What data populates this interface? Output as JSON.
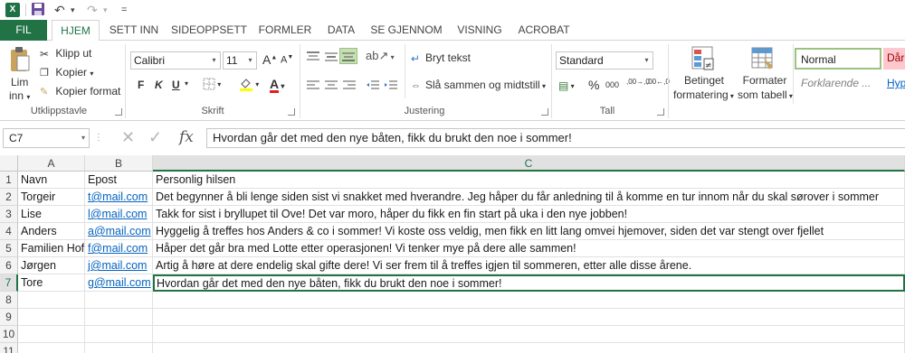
{
  "quick_access": {
    "logo": "X",
    "undo": "↶",
    "redo": "↷",
    "customize": "="
  },
  "tabs": [
    {
      "label": "FIL"
    },
    {
      "label": "HJEM"
    },
    {
      "label": "SETT INN"
    },
    {
      "label": "SIDEOPPSETT"
    },
    {
      "label": "FORMLER"
    },
    {
      "label": "DATA"
    },
    {
      "label": "SE GJENNOM"
    },
    {
      "label": "VISNING"
    },
    {
      "label": "ACROBAT"
    }
  ],
  "ribbon": {
    "clipboard": {
      "paste_label_1": "Lim",
      "paste_label_2": "inn",
      "cut": "Klipp ut",
      "copy": "Kopier",
      "format_painter": "Kopier format",
      "group": "Utklippstavle"
    },
    "font": {
      "name": "Calibri",
      "size": "11",
      "bold": "F",
      "italic": "K",
      "underline": "U",
      "grow": "A",
      "shrink": "A",
      "color_letter": "A",
      "group": "Skrift"
    },
    "alignment": {
      "wrap_text": "Bryt tekst",
      "merge_center": "Slå sammen og midtstill",
      "group": "Justering"
    },
    "number": {
      "format": "Standard",
      "percent": "%",
      "thousands": "000",
      "dec_inc": ",00→,0",
      "dec_dec": ",00←,0",
      "group": "Tall"
    },
    "styles": {
      "conditional_1": "Betinget",
      "conditional_2": "formatering",
      "format_table_1": "Formater",
      "format_table_2": "som tabell",
      "normal": "Normal",
      "bad": "Dårl",
      "explanatory": "Forklarende ...",
      "hyperlink": "Hyp"
    }
  },
  "formula_bar": {
    "name_box": "C7",
    "cancel": "✕",
    "enter": "✓",
    "fx": "fx",
    "content": "Hvordan går det med den nye båten, fikk du brukt den noe i sommer!"
  },
  "columns": [
    "A",
    "B",
    "C"
  ],
  "rows": [
    {
      "num": "1",
      "a": "Navn",
      "b": "Epost",
      "c": "Personlig hilsen"
    },
    {
      "num": "2",
      "a": "Torgeir",
      "b": "t@mail.com",
      "c": "Det begynner å bli lenge siden sist vi snakket med hverandre. Jeg håper du får anledning til å komme en tur innom når du skal sørover i sommer"
    },
    {
      "num": "3",
      "a": "Lise",
      "b": "l@mail.com",
      "c": "Takk for sist i bryllupet til Ove! Det var moro, håper du fikk en fin start på uka i den nye jobben!"
    },
    {
      "num": "4",
      "a": "Anders",
      "b": "a@mail.com",
      "c": "Hyggelig å treffes hos Anders & co i sommer! Vi koste oss veldig, men fikk en litt lang omvei hjemover, siden det var stengt over fjellet"
    },
    {
      "num": "5",
      "a": "Familien Hof",
      "b": "f@mail.com",
      "c": "Håper det går bra med Lotte etter operasjonen! Vi tenker mye på dere alle sammen!"
    },
    {
      "num": "6",
      "a": "Jørgen",
      "b": "j@mail.com",
      "c": "Artig å høre at dere endelig skal gifte dere! Vi ser frem til å treffes igjen til sommeren, etter alle disse årene."
    },
    {
      "num": "7",
      "a": "Tore",
      "b": "g@mail.com",
      "c": "Hvordan går det med den nye båten, fikk du brukt den noe i sommer!"
    },
    {
      "num": "8",
      "a": "",
      "b": "",
      "c": ""
    },
    {
      "num": "9",
      "a": "",
      "b": "",
      "c": ""
    },
    {
      "num": "10",
      "a": "",
      "b": "",
      "c": ""
    },
    {
      "num": "11",
      "a": "",
      "b": "",
      "c": ""
    }
  ],
  "selection": {
    "cell": "C7",
    "row": "7",
    "column": "C"
  }
}
